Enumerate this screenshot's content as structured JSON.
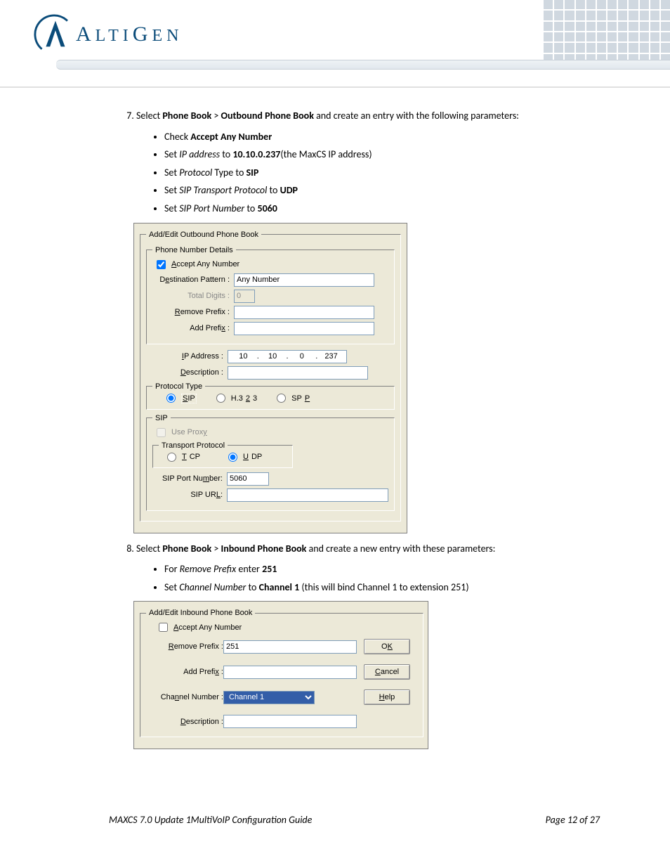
{
  "header": {
    "brand": "ALTIGEN"
  },
  "step7": {
    "num": "7.",
    "text_pre": "Select ",
    "pb": "Phone Book",
    "sep": " > ",
    "ob": "Outbound Phone Book",
    "text_post": " and create an entry with the following parameters:",
    "bullets": {
      "b1_pre": "Check ",
      "b1_bold": "Accept Any Number",
      "b2_pre": "Set ",
      "b2_ital": "IP address",
      "b2_mid": " to ",
      "b2_bold": "10.10.0.237",
      "b2_post": "(the MaxCS IP address)",
      "b3_pre": "Set ",
      "b3_ital": "Protocol",
      "b3_mid": " Type to ",
      "b3_bold": "SIP",
      "b4_pre": "Set ",
      "b4_ital": "SIP Transport Protocol",
      "b4_mid": " to ",
      "b4_bold": "UDP",
      "b5_pre": "Set ",
      "b5_ital": "SIP Port Number",
      "b5_mid": " to ",
      "b5_bold": "5060"
    }
  },
  "outbound": {
    "legend_main": "Add/Edit Outbound Phone Book",
    "legend_pnd": "Phone Number Details",
    "accept_any": "Accept Any Number",
    "dest_pattern_lbl": "Destination Pattern :",
    "dest_pattern_val": "Any Number",
    "total_digits_lbl": "Total Digits :",
    "total_digits_val": "0",
    "remove_prefix_lbl": "Remove Prefix :",
    "remove_prefix_val": "",
    "add_prefix_lbl": "Add Prefix :",
    "add_prefix_val": "",
    "ip_lbl": "IP Address :",
    "ip": {
      "o1": "10",
      "o2": "10",
      "o3": "0",
      "o4": "237"
    },
    "desc_lbl": "Description :",
    "desc_val": "",
    "legend_proto": "Protocol Type",
    "proto": {
      "sip": "SIP",
      "h323": "H.323",
      "spp": "SPP"
    },
    "legend_sip": "SIP",
    "use_proxy": "Use Proxy",
    "legend_tp": "Transport Protocol",
    "tp": {
      "tcp": "TCP",
      "udp": "UDP"
    },
    "sip_port_lbl": "SIP Port Number:",
    "sip_port_val": "5060",
    "sip_url_lbl": "SIP URL:",
    "sip_url_val": ""
  },
  "step8": {
    "num": "8.",
    "text_pre": "Select ",
    "pb": "Phone Book",
    "sep": " > ",
    "ib": "Inbound Phone Book",
    "text_post": " and create a new entry with these parameters:",
    "bullets": {
      "b1_pre": "For ",
      "b1_ital": "Remove Prefix",
      "b1_mid": " enter ",
      "b1_bold": "251",
      "b2_pre": "Set ",
      "b2_ital": "Channel Number",
      "b2_mid": " to ",
      "b2_bold": "Channel 1",
      "b2_post": " (this will bind Channel 1 to extension 251)"
    }
  },
  "inbound": {
    "legend_main": "Add/Edit Inbound Phone Book",
    "accept_any": "Accept Any Number",
    "remove_prefix_lbl": "Remove Prefix :",
    "remove_prefix_val": "251",
    "add_prefix_lbl": "Add Prefix :",
    "add_prefix_val": "",
    "channel_lbl": "Channel Number :",
    "channel_val": "Channel 1",
    "desc_lbl": "Description :",
    "desc_val": "",
    "btn_ok": "OK",
    "btn_cancel": "Cancel",
    "btn_help": "Help"
  },
  "footer": {
    "title": "MAXCS 7.0 Update 1MultiVoIP Configuration Guide",
    "page": "Page 12 of 27"
  }
}
